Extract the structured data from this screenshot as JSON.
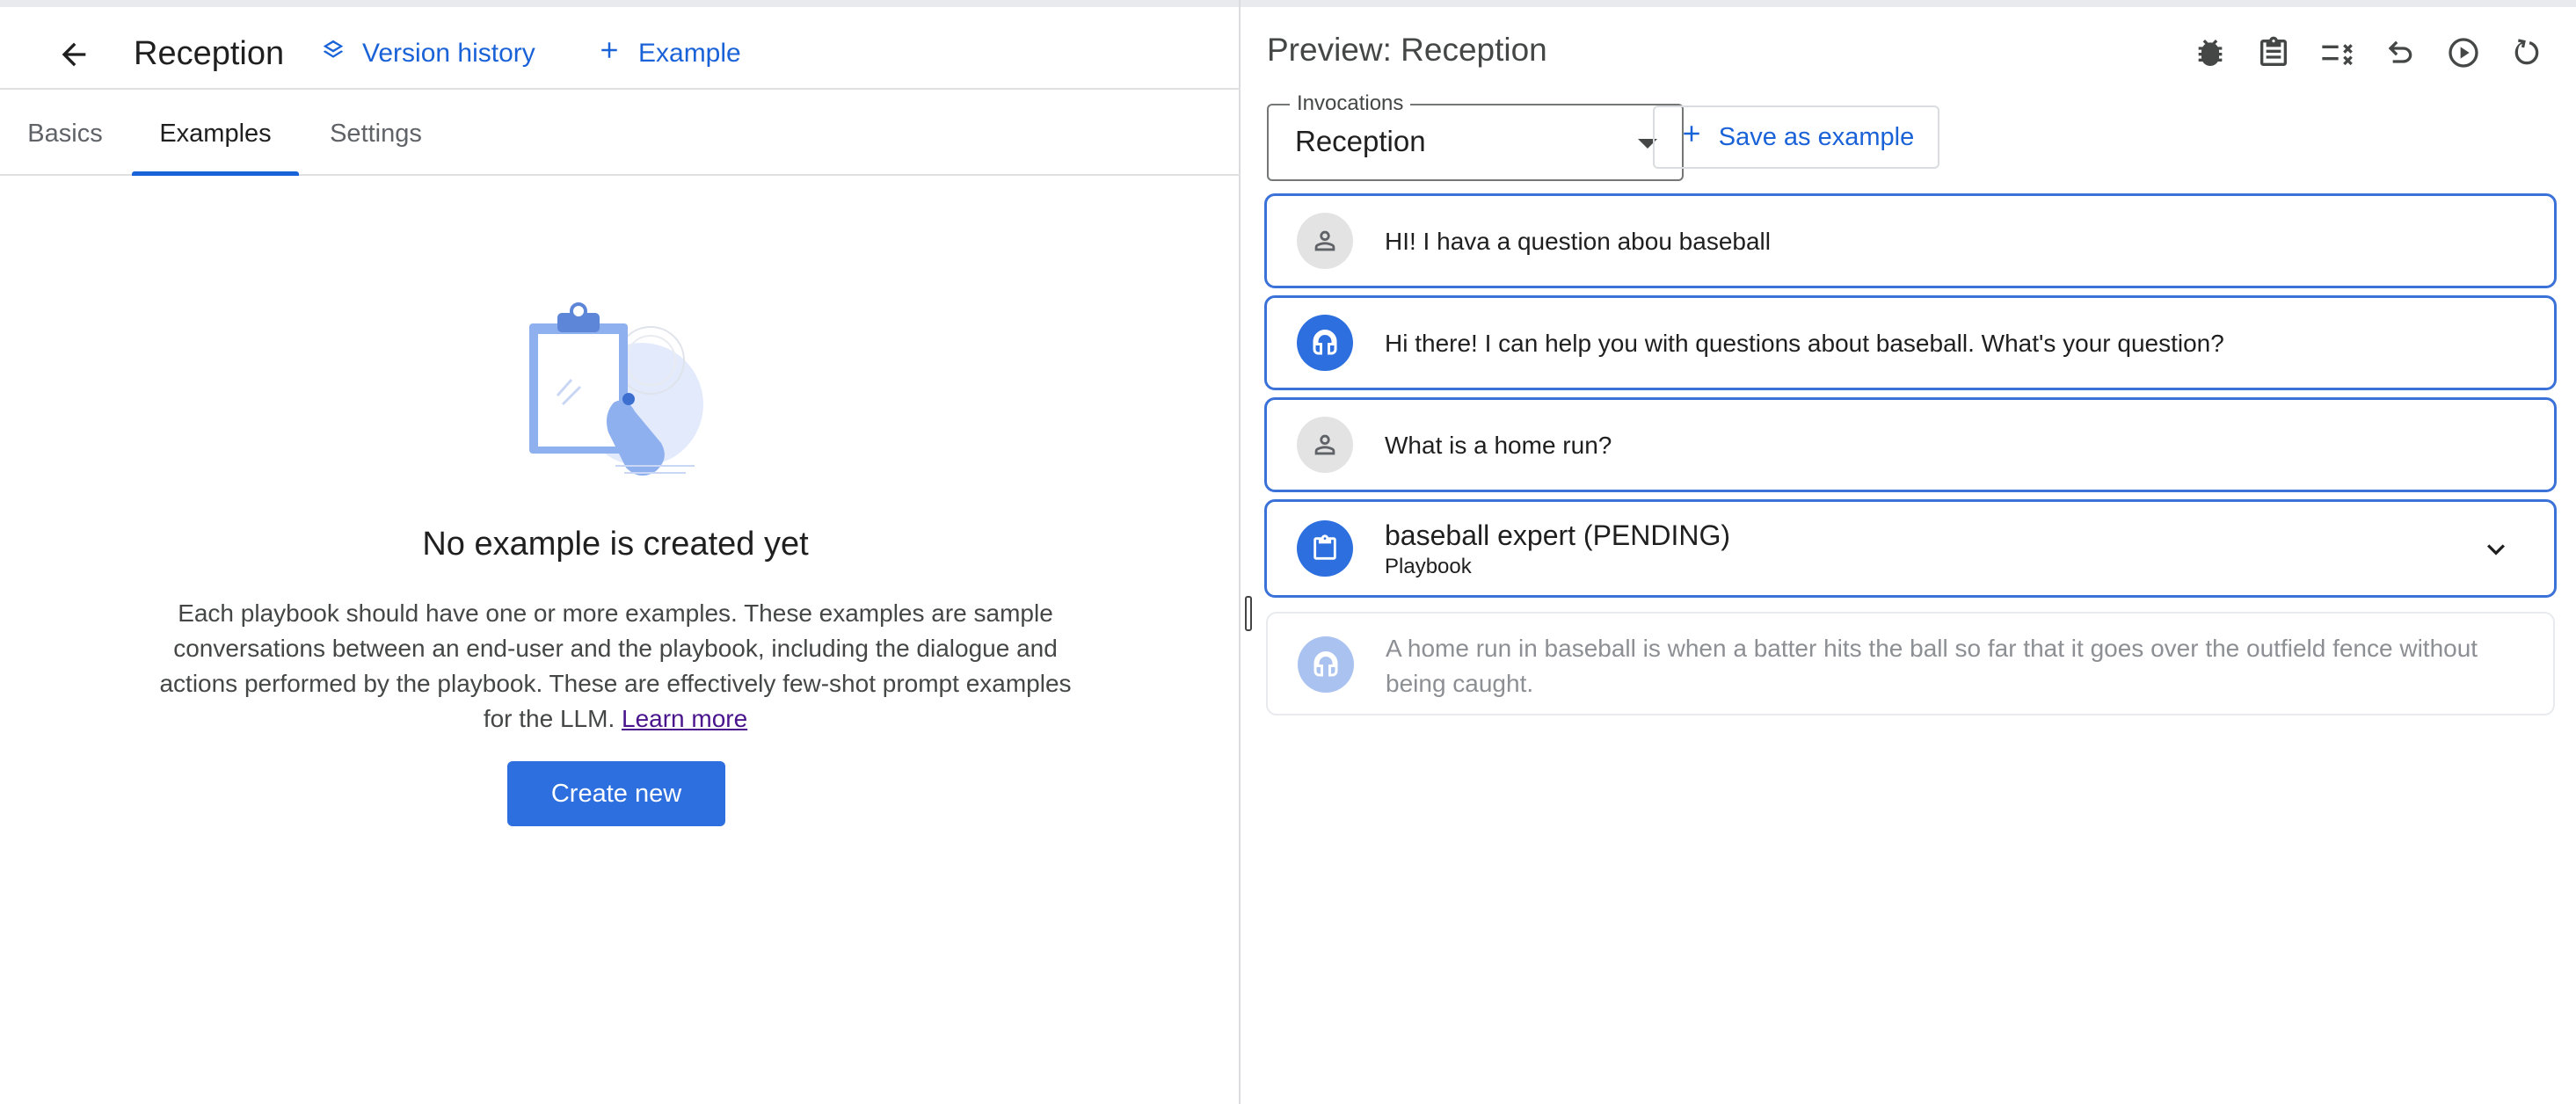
{
  "header": {
    "title": "Reception",
    "version_history_label": "Version history",
    "add_example_label": "Example"
  },
  "tabs": [
    {
      "label": "Basics",
      "active": false
    },
    {
      "label": "Examples",
      "active": true
    },
    {
      "label": "Settings",
      "active": false
    }
  ],
  "empty_state": {
    "title": "No example is created yet",
    "description": "Each playbook should have one or more examples. These examples are sample conversations between an end-user and the playbook, including the dialogue and actions performed by the playbook. These are effectively few-shot prompt examples for the LLM.",
    "learn_more": "Learn more",
    "create_button": "Create new"
  },
  "preview": {
    "title": "Preview: Reception",
    "toolbar_icons": [
      "bug-icon",
      "clipboard-icon",
      "checklist-icon",
      "undo-icon",
      "play-icon",
      "reset-icon"
    ],
    "invocations": {
      "label": "Invocations",
      "value": "Reception"
    },
    "save_example_label": "Save as example",
    "messages": [
      {
        "role": "user",
        "text": "HI! I hava a question abou baseball"
      },
      {
        "role": "agent",
        "text": "Hi there! I can help you with questions about baseball. What's your question?"
      },
      {
        "role": "user",
        "text": "What is a home run?"
      },
      {
        "role": "playbook",
        "name": "baseball expert (PENDING)",
        "type": "Playbook"
      },
      {
        "role": "agent-pending",
        "text": "A home run in baseball is when a batter hits the ball so far that it goes over the outfield fence without being caught."
      }
    ]
  },
  "colors": {
    "accent": "#1a62d8",
    "primary_button": "#2d6fdf",
    "message_border": "#3b72d8"
  }
}
